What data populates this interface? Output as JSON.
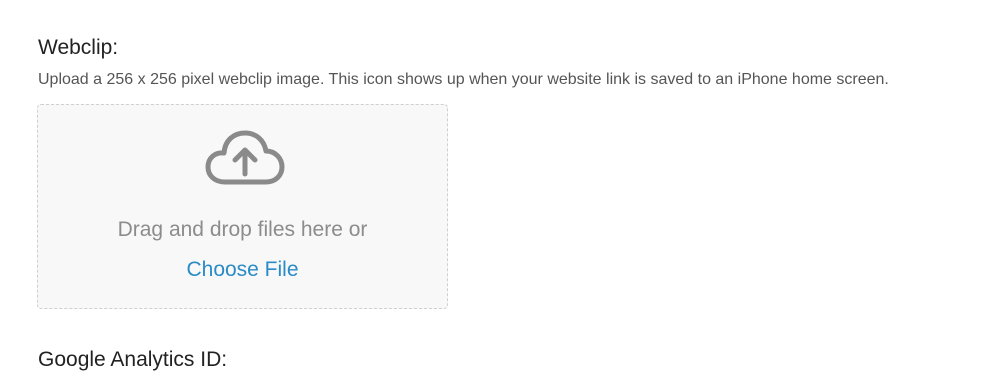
{
  "webclip": {
    "title": "Webclip:",
    "description": "Upload a 256 x 256 pixel webclip image. This icon shows up when your website link is saved to an iPhone home screen.",
    "dropzone": {
      "icon": "cloud-upload-icon",
      "drop_text": "Drag and drop files here or",
      "choose_file_label": "Choose File"
    }
  },
  "google_analytics": {
    "title": "Google Analytics ID:"
  },
  "colors": {
    "link": "#2a8bc7",
    "muted_text": "#8c8c8c",
    "icon": "#8a8a8a"
  }
}
